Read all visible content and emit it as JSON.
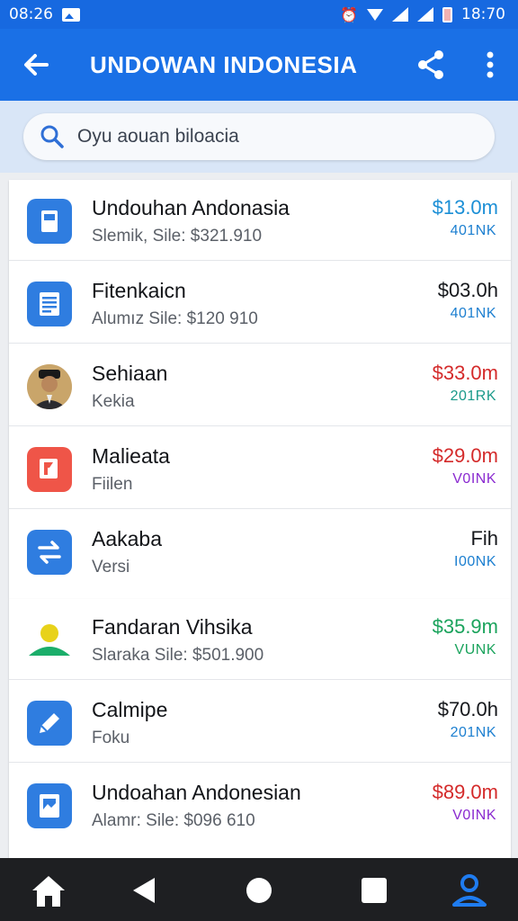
{
  "status_bar": {
    "time_left": "08:26",
    "time_right": "18:70"
  },
  "app_bar": {
    "title": "UNDOWAN INDONESIA",
    "back_icon": "arrow-left",
    "share_icon": "share",
    "more_icon": "more-vertical"
  },
  "search": {
    "text": "Oyu aouan biloacia"
  },
  "items": [
    {
      "name": "Undouhan Andonasia",
      "sub": "Slemik, Sile: $321.910",
      "amount": "$13.0m",
      "amount_color": "#1c8fd6",
      "tag": "401NK",
      "tag_color": "#1c7fd0",
      "icon": "document-icon",
      "icon_bg": "#2f7de0"
    },
    {
      "name": "Fitenkaicn",
      "sub": "Alumız Sile: $120 910",
      "amount": "$03.0h",
      "amount_color": "#16181c",
      "tag": "401NK",
      "tag_color": "#1c7fd0",
      "icon": "list-document-icon",
      "icon_bg": "#2f7de0"
    },
    {
      "name": "Sehiaan",
      "sub": "Kekia",
      "amount": "$33.0m",
      "amount_color": "#d42a2a",
      "tag": "201RK",
      "tag_color": "#1a9a8a",
      "icon": "person-avatar",
      "icon_bg": "#3a2a22"
    },
    {
      "name": "Malieata",
      "sub": "Fiilen",
      "amount": "$29.0m",
      "amount_color": "#d42a2a",
      "tag": "V0INK",
      "tag_color": "#8a2ad0",
      "icon": "flag-icon",
      "icon_bg": "#ef5548"
    },
    {
      "name": "Aakaba",
      "sub": "Versi",
      "amount": "Fih",
      "amount_color": "#16181c",
      "tag": "I00NK",
      "tag_color": "#1c7fd0",
      "icon": "transfer-icon",
      "icon_bg": "#2f7de0"
    },
    {
      "name": "Fandaran Vihsika",
      "sub": "Slaraka Sile: $501.900",
      "amount": "$35.9m",
      "amount_color": "#1aa35c",
      "tag": "VUNK",
      "tag_color": "#1aa35c",
      "icon": "user-icon",
      "icon_bg": "#ffffff"
    },
    {
      "name": "Calmipe",
      "sub": "Foku",
      "amount": "$70.0h",
      "amount_color": "#16181c",
      "tag": "201NK",
      "tag_color": "#1c7fd0",
      "icon": "edit-icon",
      "icon_bg": "#2f7de0"
    },
    {
      "name": "Undoahan Andonesian",
      "sub": "Alamr: Sile: $096 610",
      "amount": "$89.0m",
      "amount_color": "#d42a2a",
      "tag": "V0INK",
      "tag_color": "#8a2ad0",
      "icon": "image-file-icon",
      "icon_bg": "#2f7de0"
    }
  ],
  "nav_bar": {
    "buttons": [
      "home-icon",
      "back-triangle-icon",
      "circle-home-icon",
      "square-recents-icon",
      "profile-icon"
    ]
  }
}
